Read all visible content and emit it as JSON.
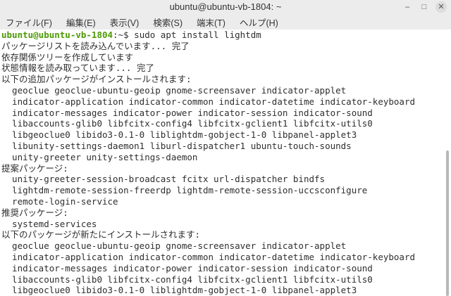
{
  "window": {
    "title": "ubuntu@ubuntu-vb-1804: ~"
  },
  "menu": [
    "ファイル(F)",
    "編集(E)",
    "表示(V)",
    "検索(S)",
    "端末(T)",
    "ヘルプ(H)"
  ],
  "prompt": {
    "user": "ubuntu@ubuntu-vb-1804",
    "path": ":~",
    "symbol": "$ ",
    "command": "sudo apt install lightdm"
  },
  "lines": [
    "パッケージリストを読み込んでいます... 完了",
    "依存関係ツリーを作成しています",
    "状態情報を読み取っています... 完了",
    "以下の追加パッケージがインストールされます:",
    "  geoclue geoclue-ubuntu-geoip gnome-screensaver indicator-applet",
    "  indicator-application indicator-common indicator-datetime indicator-keyboard",
    "  indicator-messages indicator-power indicator-session indicator-sound",
    "  libaccounts-glib0 libfcitx-config4 libfcitx-gclient1 libfcitx-utils0",
    "  libgeoclue0 libido3-0.1-0 liblightdm-gobject-1-0 libpanel-applet3",
    "  libunity-settings-daemon1 liburl-dispatcher1 ubuntu-touch-sounds",
    "  unity-greeter unity-settings-daemon",
    "提案パッケージ:",
    "  unity-greeter-session-broadcast fcitx url-dispatcher bindfs",
    "  lightdm-remote-session-freerdp lightdm-remote-session-uccsconfigure",
    "  remote-login-service",
    "推奨パッケージ:",
    "  systemd-services",
    "以下のパッケージが新たにインストールされます:",
    "  geoclue geoclue-ubuntu-geoip gnome-screensaver indicator-applet",
    "  indicator-application indicator-common indicator-datetime indicator-keyboard",
    "  indicator-messages indicator-power indicator-session indicator-sound",
    "  libaccounts-glib0 libfcitx-config4 libfcitx-gclient1 libfcitx-utils0",
    "  libgeoclue0 libido3-0.1-0 liblightdm-gobject-1-0 libpanel-applet3"
  ],
  "colors": {
    "prompt_user": "#4e9a06",
    "prompt_path": "#3465a4",
    "text": "#2e2e2e",
    "chrome": "#ececec"
  }
}
